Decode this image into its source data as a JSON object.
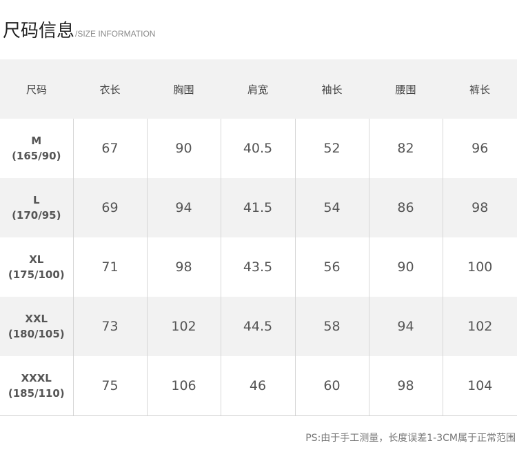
{
  "title": {
    "main": "尺码信息",
    "sub": "/SIZE INFORMATION"
  },
  "table": {
    "headers": [
      "尺码",
      "衣长",
      "胸围",
      "肩宽",
      "袖长",
      "腰围",
      "裤长"
    ],
    "rows": [
      {
        "size": "M",
        "fit": "(165/90)",
        "values": [
          "67",
          "90",
          "40.5",
          "52",
          "82",
          "96"
        ]
      },
      {
        "size": "L",
        "fit": "(170/95)",
        "values": [
          "69",
          "94",
          "41.5",
          "54",
          "86",
          "98"
        ]
      },
      {
        "size": "XL",
        "fit": "(175/100)",
        "values": [
          "71",
          "98",
          "43.5",
          "56",
          "90",
          "100"
        ]
      },
      {
        "size": "XXL",
        "fit": "(180/105)",
        "values": [
          "73",
          "102",
          "44.5",
          "58",
          "94",
          "102"
        ]
      },
      {
        "size": "XXXL",
        "fit": "(185/110)",
        "values": [
          "75",
          "106",
          "46",
          "60",
          "98",
          "104"
        ]
      }
    ]
  },
  "note": "PS:由于手工测量，长度误差1-3CM属于正常范围"
}
